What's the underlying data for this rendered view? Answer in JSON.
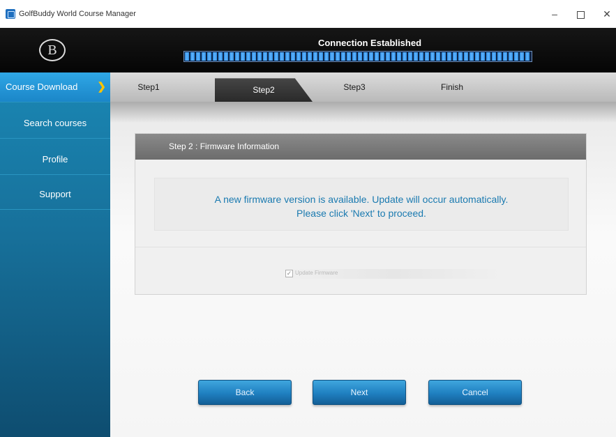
{
  "window": {
    "title": "GolfBuddy World Course Manager",
    "minimize": "–",
    "close": "✕"
  },
  "header": {
    "logo_glyph": "B",
    "status": "Connection Established",
    "progress": 1.0
  },
  "sidebar": {
    "items": [
      {
        "label": "Course Download",
        "active": true,
        "arrow": "❯"
      },
      {
        "label": "Search courses"
      },
      {
        "label": "Profile"
      },
      {
        "label": "Support"
      }
    ]
  },
  "steps": [
    {
      "label": "Step1"
    },
    {
      "label": "Step2",
      "active": true
    },
    {
      "label": "Step3"
    },
    {
      "label": "Finish"
    }
  ],
  "panel": {
    "title": "Step 2 : Firmware Information",
    "message_line1": "A new firmware version is available.  Update will occur automatically.",
    "message_line2": "Please click 'Next' to proceed.",
    "checkbox": {
      "label": "Update Firmware",
      "checked": true,
      "check_glyph": "✓"
    }
  },
  "buttons": {
    "back": "Back",
    "next": "Next",
    "cancel": "Cancel"
  },
  "colors": {
    "accent": "#1f7fc0",
    "message_text": "#1a7ab0",
    "nav_arrow": "#ffc400"
  }
}
